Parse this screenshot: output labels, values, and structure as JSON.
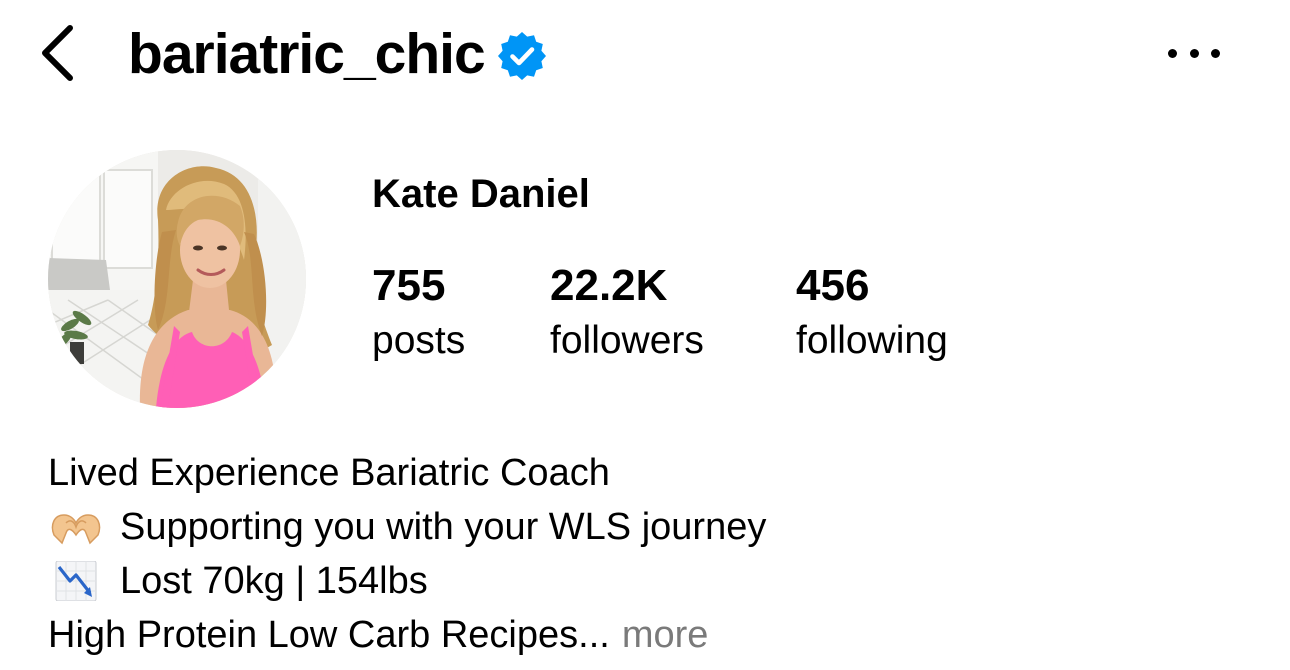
{
  "header": {
    "username": "bariatric_chic",
    "verified": true,
    "back_icon": "chevron-left-icon",
    "more_icon": "ellipsis-horizontal-icon",
    "verified_color": "#0095F6"
  },
  "profile": {
    "name": "Kate Daniel",
    "stats": [
      {
        "count": "755",
        "label": "posts"
      },
      {
        "count": "22.2K",
        "label": "followers"
      },
      {
        "count": "456",
        "label": "following"
      }
    ]
  },
  "bio": {
    "lines": [
      {
        "emoji": "",
        "text": "Lived Experience Bariatric Coach"
      },
      {
        "emoji": "heart-hands-icon",
        "text": "Supporting you with your WLS journey"
      },
      {
        "emoji": "chart-decreasing-icon",
        "text": "Lost 70kg | 154lbs"
      },
      {
        "emoji": "",
        "text": "High Protein Low Carb Recipes..."
      }
    ],
    "more_label": "more"
  },
  "colors": {
    "text": "#000000",
    "muted": "#7A7A7A",
    "accent": "#0095F6"
  }
}
